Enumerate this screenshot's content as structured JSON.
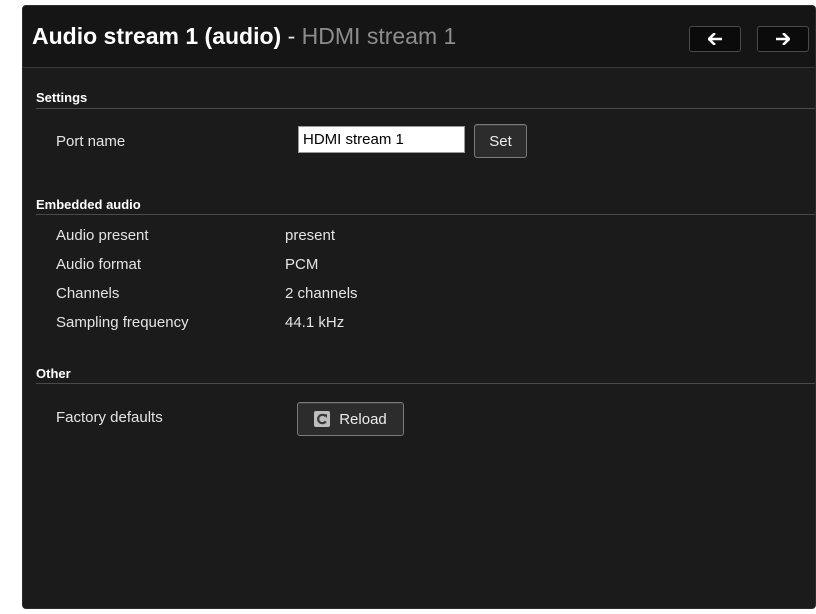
{
  "header": {
    "title_main": "Audio stream 1 (audio)",
    "title_separator": " - ",
    "title_sub": "HDMI stream 1",
    "prev_icon": "arrow-left-icon",
    "next_icon": "arrow-right-icon"
  },
  "settings": {
    "section_title": "Settings",
    "port_name_label": "Port name",
    "port_name_value": "HDMI stream 1",
    "set_button_label": "Set"
  },
  "embedded_audio": {
    "section_title": "Embedded audio",
    "rows": [
      {
        "label": "Audio present",
        "value": "present"
      },
      {
        "label": "Audio format",
        "value": "PCM"
      },
      {
        "label": "Channels",
        "value": "2 channels"
      },
      {
        "label": "Sampling frequency",
        "value": "44.1 kHz"
      }
    ]
  },
  "other": {
    "section_title": "Other",
    "factory_defaults_label": "Factory defaults",
    "reload_button_label": "Reload",
    "reload_icon": "reload-icon"
  },
  "colors": {
    "panel_background": "#1b1b1b",
    "header_background": "#151515",
    "text_primary": "#ffffff",
    "text_secondary": "#8d8d8d"
  }
}
